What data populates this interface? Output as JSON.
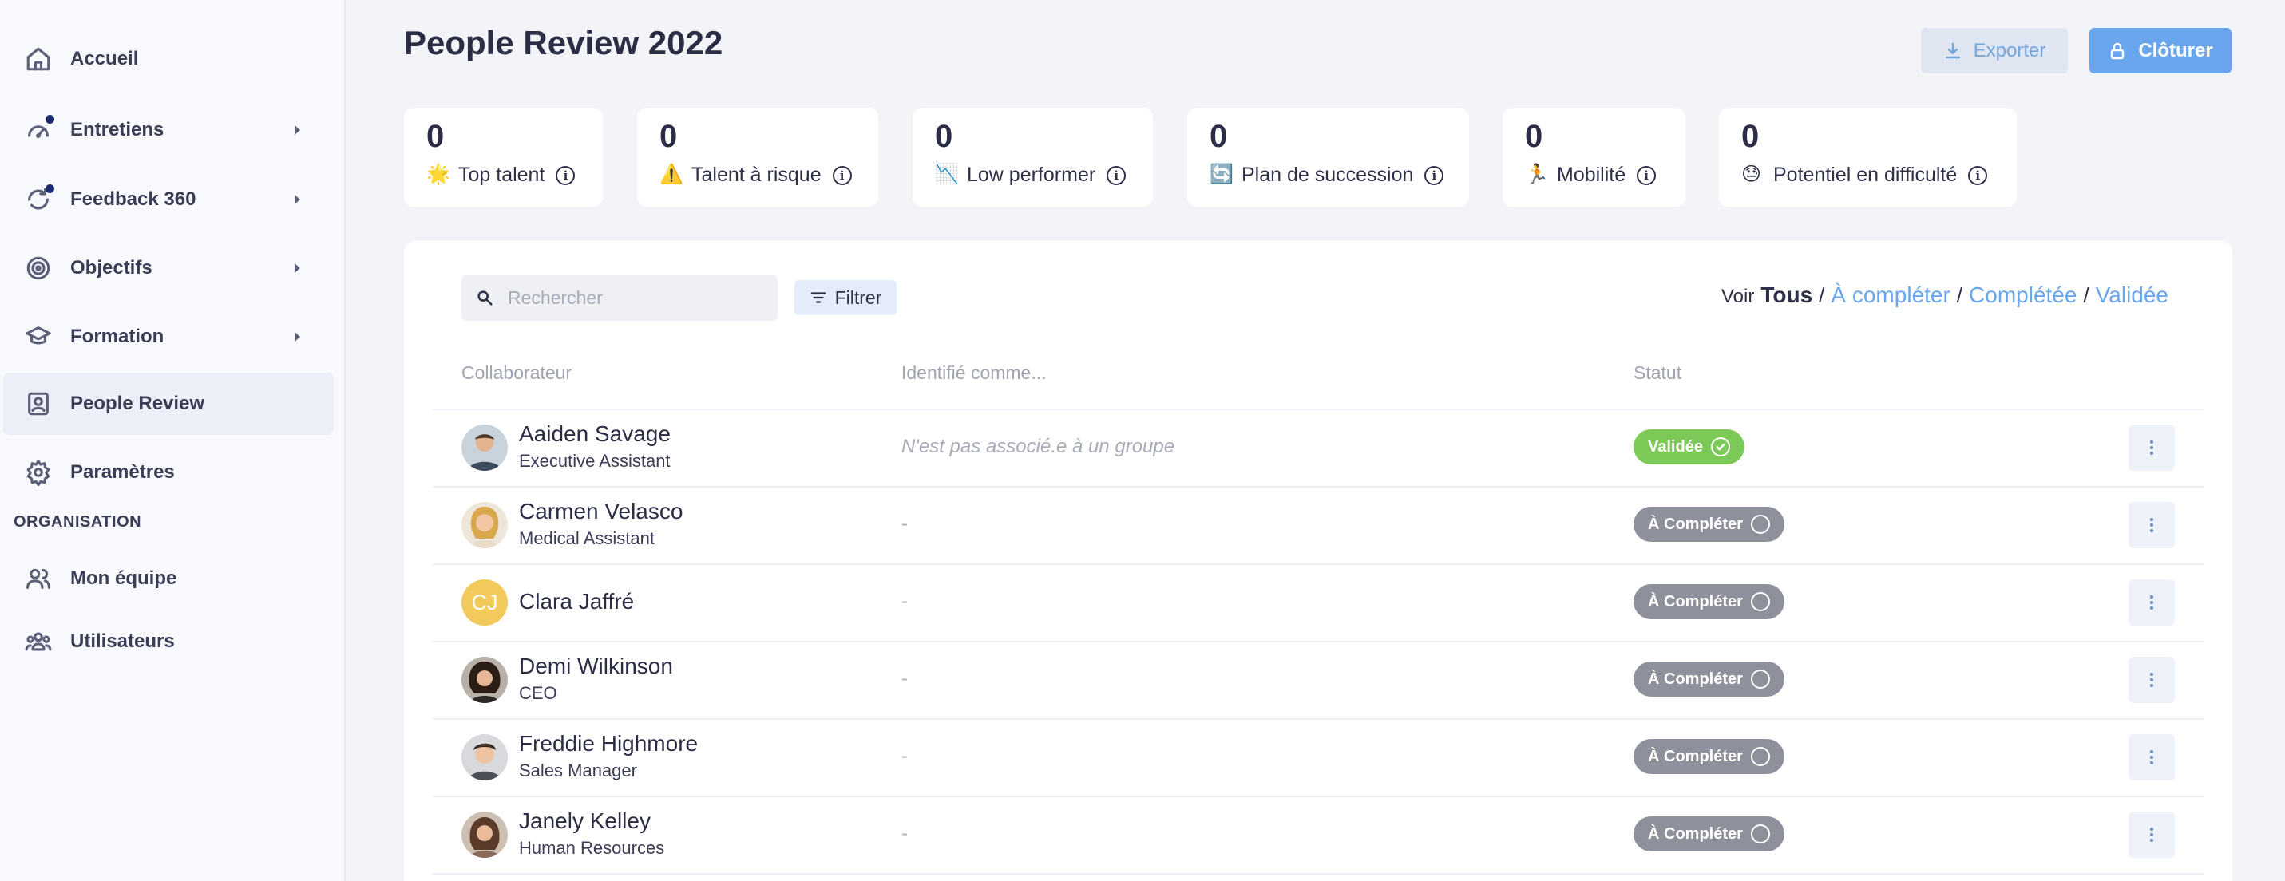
{
  "sidebar": {
    "items": [
      {
        "label": "Accueil"
      },
      {
        "label": "Entretiens"
      },
      {
        "label": "Feedback 360"
      },
      {
        "label": "Objectifs"
      },
      {
        "label": "Formation"
      },
      {
        "label": "People Review"
      },
      {
        "label": "Paramètres"
      }
    ],
    "section_title": "ORGANISATION",
    "org_items": [
      {
        "label": "Mon équipe"
      },
      {
        "label": "Utilisateurs"
      }
    ]
  },
  "header": {
    "title": "People Review 2022",
    "export_label": "Exporter",
    "close_label": "Clôturer"
  },
  "stats": [
    {
      "value": "0",
      "emoji": "🌟",
      "label": "Top talent"
    },
    {
      "value": "0",
      "emoji": "⚠️",
      "label": "Talent à risque"
    },
    {
      "value": "0",
      "emoji": "📉",
      "label": "Low performer"
    },
    {
      "value": "0",
      "emoji": "🔄",
      "label": "Plan de succession"
    },
    {
      "value": "0",
      "emoji": "🏃",
      "label": "Mobilité"
    },
    {
      "value": "0",
      "emoji": "😓",
      "label": "Potentiel en difficulté"
    }
  ],
  "toolbar": {
    "search_placeholder": "Rechercher",
    "filter_label": "Filtrer",
    "view_label": "Voir",
    "view_current": "Tous",
    "view_options": [
      "À compléter",
      "Complétée",
      "Validée"
    ]
  },
  "table": {
    "columns": [
      "Collaborateur",
      "Identifié comme...",
      "Statut"
    ],
    "rows": [
      {
        "name": "Aaiden Savage",
        "role": "Executive Assistant",
        "identified": "N'est pas associé.e à un groupe",
        "status": "Validée"
      },
      {
        "name": "Carmen Velasco",
        "role": "Medical Assistant",
        "identified": "-",
        "status": "À Compléter"
      },
      {
        "name": "Clara Jaffré",
        "role": "",
        "initials": "CJ",
        "identified": "-",
        "status": "À Compléter"
      },
      {
        "name": "Demi Wilkinson",
        "role": "CEO",
        "identified": "-",
        "status": "À Compléter"
      },
      {
        "name": "Freddie Highmore",
        "role": "Sales Manager",
        "identified": "-",
        "status": "À Compléter"
      },
      {
        "name": "Janely Kelley",
        "role": "Human Resources",
        "identified": "-",
        "status": "À Compléter"
      }
    ]
  }
}
